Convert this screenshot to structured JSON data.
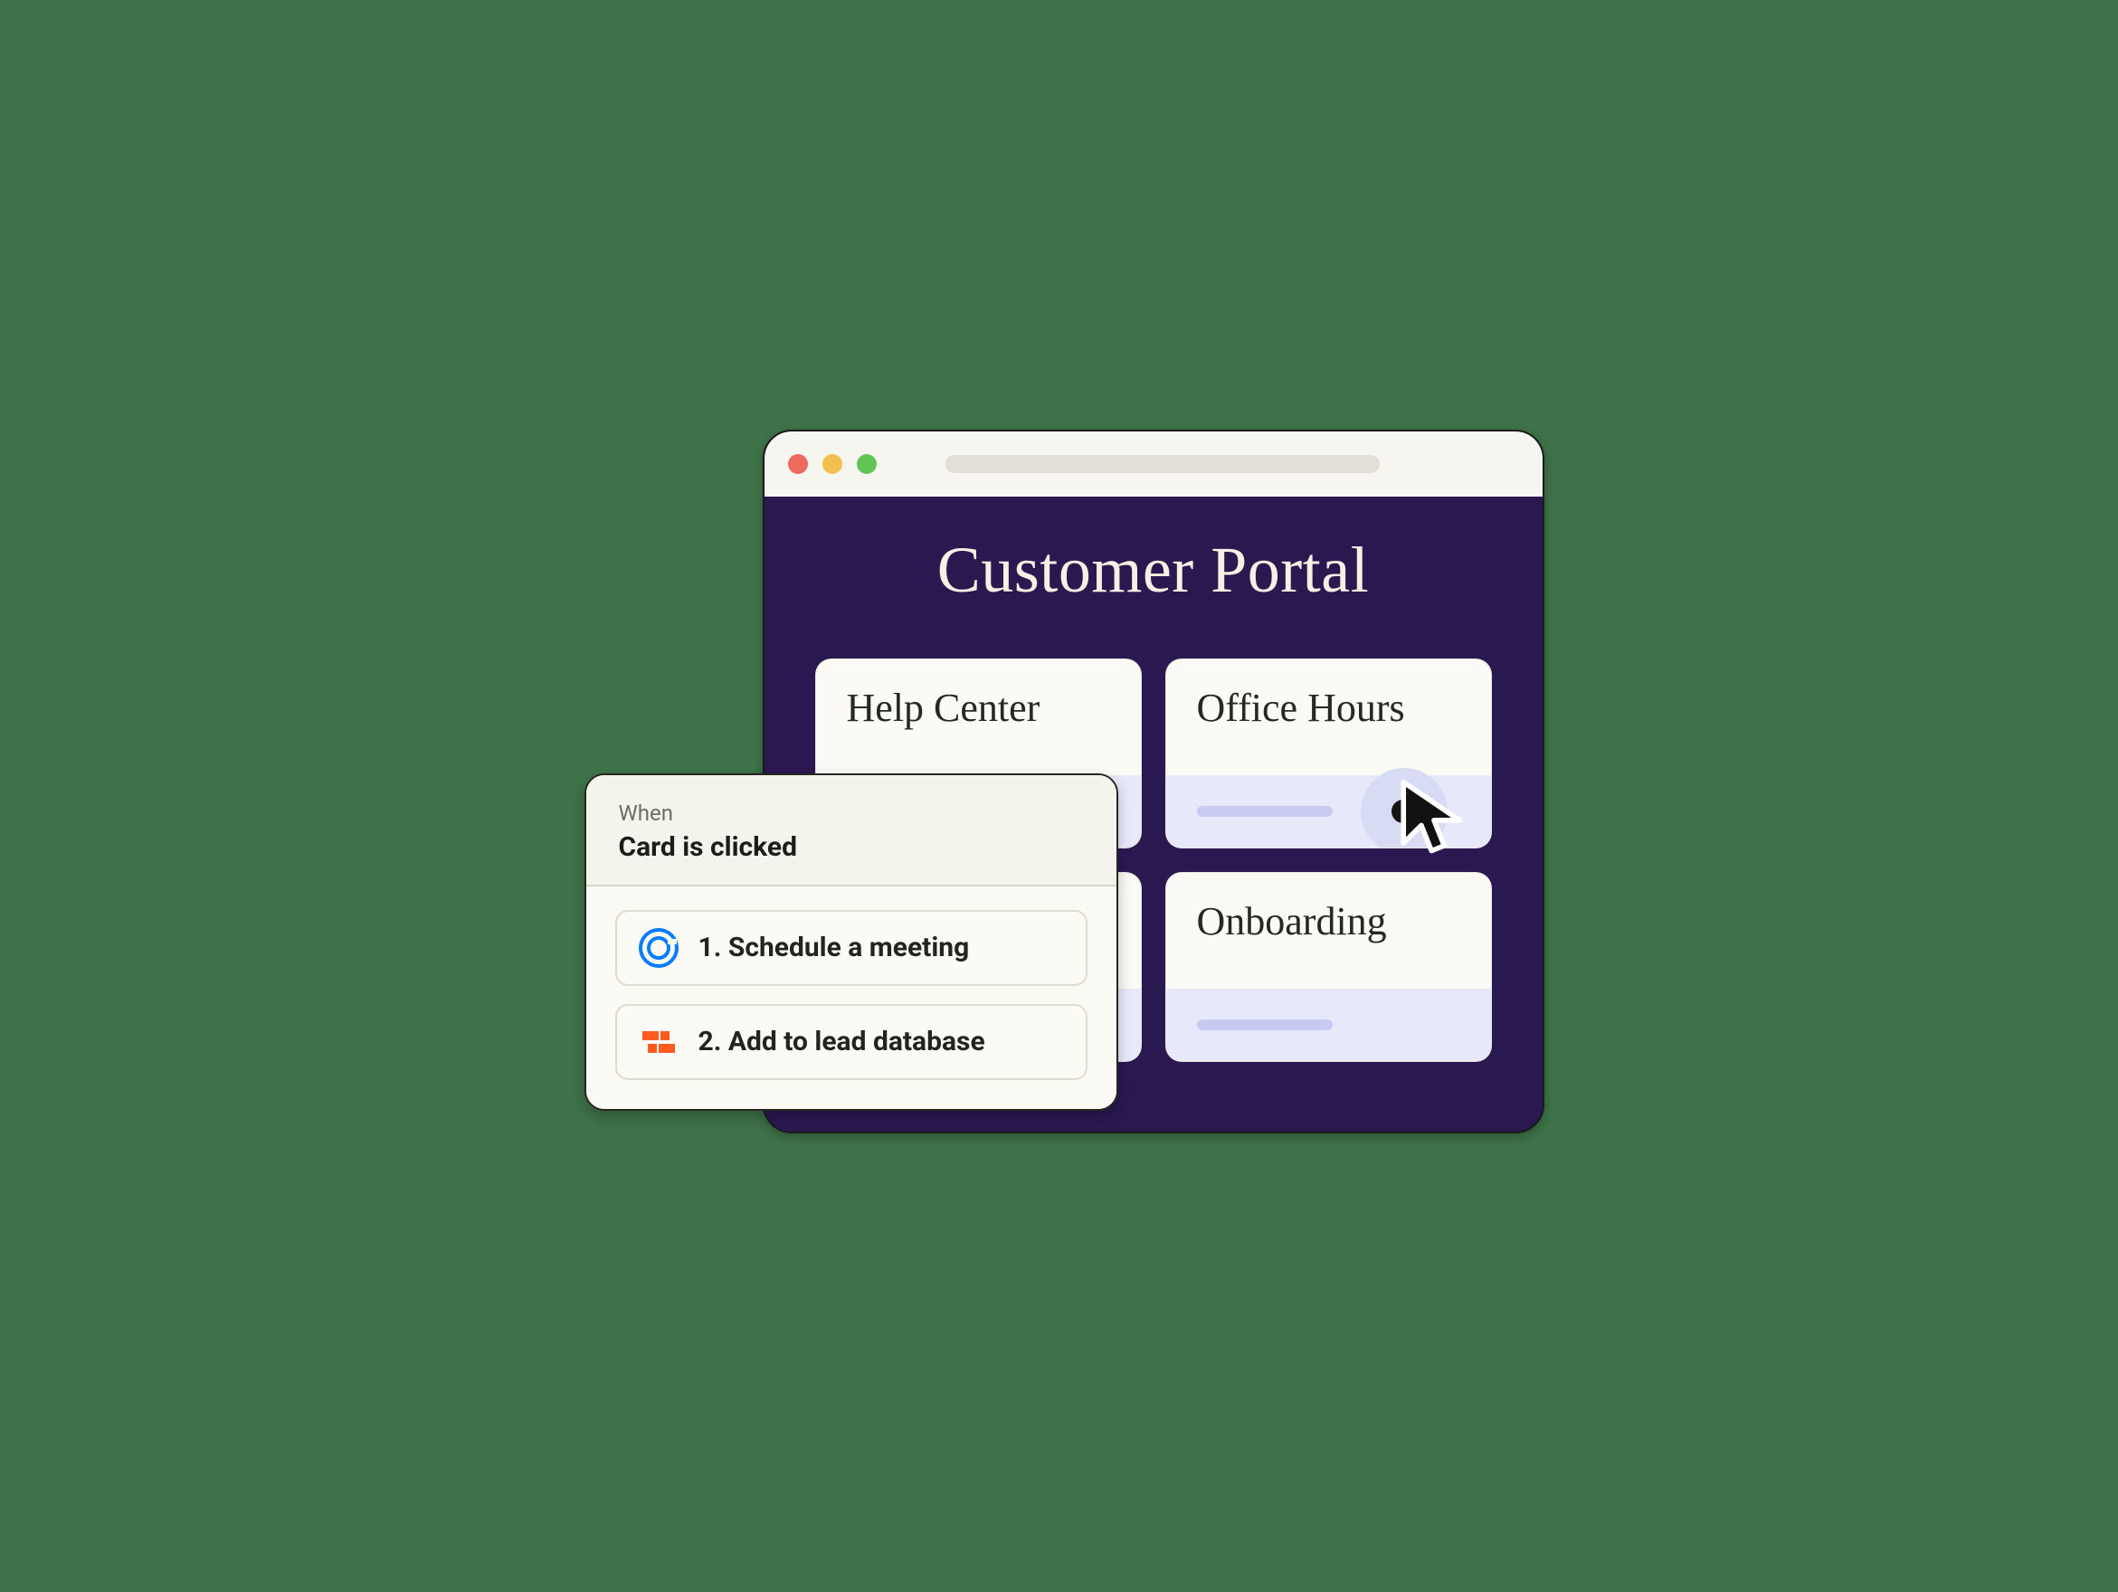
{
  "portal": {
    "title": "Customer Portal",
    "cards": [
      {
        "title": "Help Center"
      },
      {
        "title": "Office Hours"
      },
      {
        "title": ""
      },
      {
        "title": "Onboarding"
      }
    ]
  },
  "automation": {
    "when_label": "When",
    "trigger": "Card is clicked",
    "actions": [
      {
        "icon": "calendly-icon",
        "label": "1.  Schedule a meeting"
      },
      {
        "icon": "blocks-icon",
        "label": "2.  Add to lead database"
      }
    ]
  }
}
